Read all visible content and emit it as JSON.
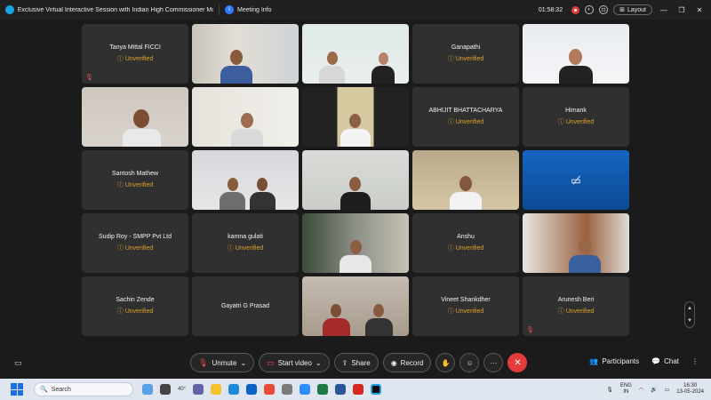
{
  "titlebar": {
    "title": "Exclusive Virtual Interactive Session with Indian High Commissioner Mozam...",
    "meeting_info": "Meeting Info",
    "info_glyph": "i",
    "timer": "01:58:32",
    "layout_label": "Layout",
    "layout_glyph": "⊞",
    "window_controls": [
      "—",
      "❐",
      "✕"
    ]
  },
  "unverified_label": "Unverified",
  "unverified_icon": "ⓘ",
  "participants": [
    {
      "name": "Tanya Mittal FICCI",
      "unverified": true,
      "muted": true
    },
    {
      "name": "",
      "video": "v1"
    },
    {
      "name": "",
      "video": "v2"
    },
    {
      "name": "Ganapathi",
      "unverified": true
    },
    {
      "name": "",
      "video": "v3"
    },
    {
      "name": "",
      "video": "v4"
    },
    {
      "name": "",
      "video": "v5"
    },
    {
      "name": "",
      "video": "v6"
    },
    {
      "name": "ABHIJIT BHATTACHARYA",
      "unverified": true
    },
    {
      "name": "Himank",
      "unverified": true
    },
    {
      "name": "Santosh Mathew",
      "unverified": true
    },
    {
      "name": "",
      "video": "v7"
    },
    {
      "name": "",
      "video": "v8"
    },
    {
      "name": "",
      "video": "v9"
    },
    {
      "name": "",
      "video": "camoff"
    },
    {
      "name": "Sudip Roy - SMPP Pvt Ltd",
      "unverified": true
    },
    {
      "name": "kamna gulati",
      "unverified": true
    },
    {
      "name": "",
      "video": "v10"
    },
    {
      "name": "Anshu",
      "unverified": true
    },
    {
      "name": "",
      "video": "v11"
    },
    {
      "name": "Sachin Zende",
      "unverified": true
    },
    {
      "name": "Gayatri G Prasad",
      "unverified": false
    },
    {
      "name": "",
      "video": "v12"
    },
    {
      "name": "Vineet Shankdher",
      "unverified": true
    },
    {
      "name": "Arunesh Beri",
      "unverified": true,
      "muted": true
    }
  ],
  "controls": {
    "chat_icon": "▭",
    "unmute": "Unmute",
    "unmute_icon": "🎙",
    "start_video": "Start video",
    "video_icon": "▭",
    "share": "Share",
    "share_icon": "⇪",
    "record": "Record",
    "record_icon": "◉",
    "hand_icon": "✋",
    "reaction_icon": "☺",
    "more_icon": "···",
    "leave_icon": "✕",
    "participants": "Participants",
    "participants_icon": "👥",
    "chat": "Chat",
    "chat_bubble_icon": "💬",
    "more_right": "⋮",
    "dropdown_icon": "⌄"
  },
  "scroller": {
    "up": "▲",
    "down": "▼"
  },
  "taskbar": {
    "search_placeholder": "Search",
    "weather": "40°",
    "lang_top": "ENG",
    "lang_bottom": "IN",
    "time": "16:30",
    "date": "13-05-2024"
  },
  "colors": {
    "tile_bg": "#303030",
    "unverified": "#e0a12a",
    "leave_red": "#e23c3c",
    "accent_blue": "#1d6fe0"
  }
}
